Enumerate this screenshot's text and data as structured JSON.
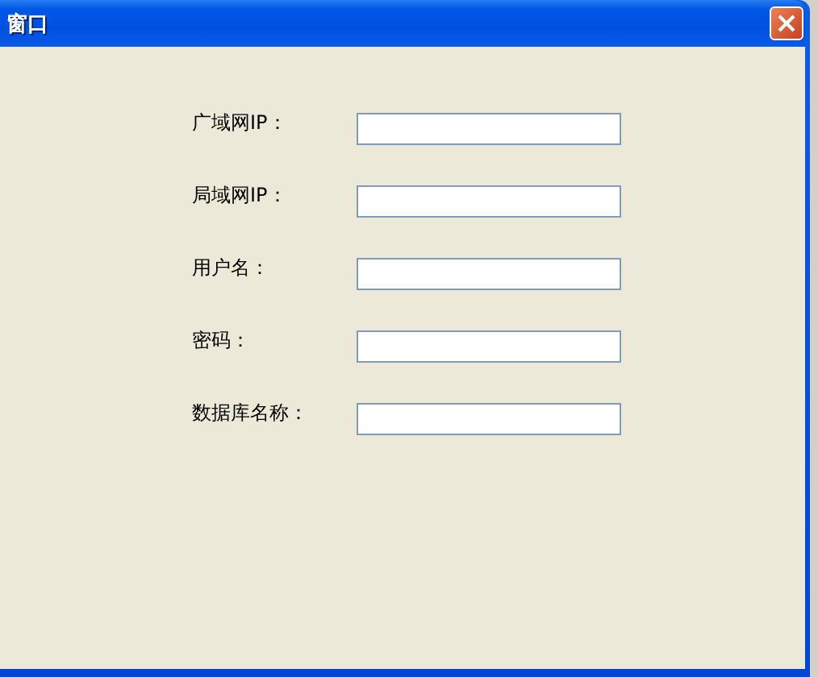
{
  "window": {
    "title": "窗口"
  },
  "fields": [
    {
      "label": "广域网IP："
    },
    {
      "label": "局域网IP："
    },
    {
      "label": "用户名："
    },
    {
      "label": "密码："
    },
    {
      "label": "数据库名称："
    }
  ]
}
